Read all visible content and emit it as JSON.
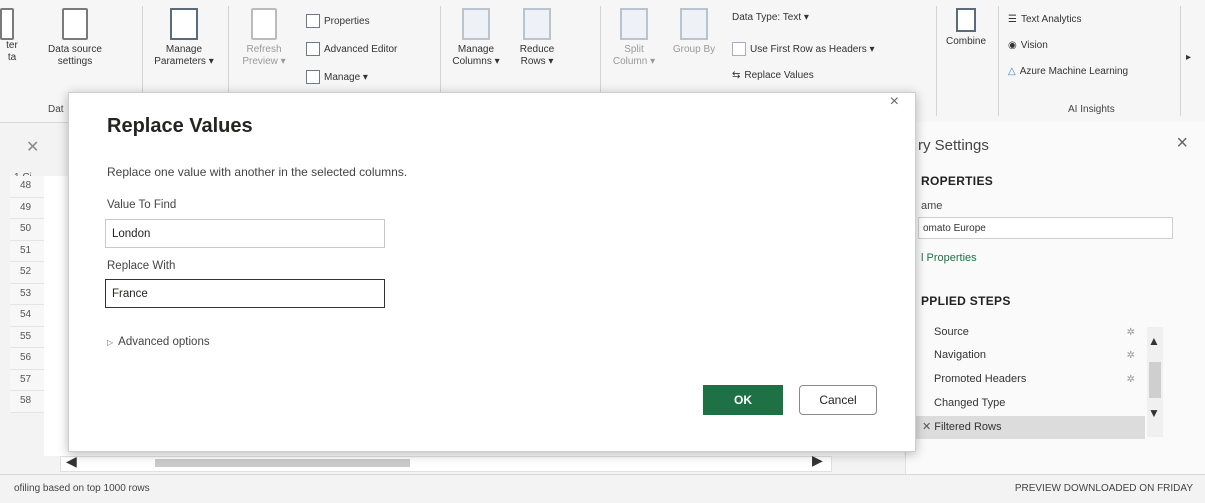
{
  "ribbon": {
    "left_cut_label_1": "ter",
    "left_cut_label_2": "ta",
    "data_source_settings": "Data source settings",
    "manage_parameters": "Manage Parameters ▾",
    "refresh_preview": "Refresh Preview ▾",
    "properties": "Properties",
    "advanced_editor": "Advanced Editor",
    "manage": "Manage ▾",
    "manage_columns": "Manage Columns ▾",
    "reduce_rows": "Reduce Rows ▾",
    "split_column": "Split Column ▾",
    "group_by": "Group By",
    "data_type": "Data Type: Text ▾",
    "use_first_row": "Use First Row as Headers ▾",
    "replace_values": "Replace Values",
    "combine": "Combine",
    "text_analytics": "Text Analytics",
    "vision": "Vision",
    "azure_ml": "Azure Machine Learning",
    "ai_insights": "AI Insights",
    "data_group_cut": "Dat"
  },
  "dialog": {
    "title": "Replace Values",
    "description": "Replace one value with another in the selected columns.",
    "value_to_find_label": "Value To Find",
    "value_to_find": "London",
    "replace_with_label": "Replace With",
    "replace_with": "France",
    "advanced_options": "Advanced options",
    "ok": "OK",
    "cancel": "Cancel",
    "close_glyph": "×"
  },
  "grid": {
    "column_header": "1 Ci",
    "row_numbers": [
      "48",
      "49",
      "50",
      "51",
      "52",
      "53",
      "54",
      "55",
      "56",
      "57",
      "58"
    ]
  },
  "query_settings": {
    "title": "ry Settings",
    "properties_head": "ROPERTIES",
    "name_label": "ame",
    "name_value": "omato Europe",
    "all_properties": "l Properties",
    "applied_steps_head": "PPLIED STEPS",
    "steps": [
      {
        "label": "Source",
        "gear": true
      },
      {
        "label": "Navigation",
        "gear": true
      },
      {
        "label": "Promoted Headers",
        "gear": true
      },
      {
        "label": "Changed Type",
        "gear": false
      },
      {
        "label": "Filtered Rows",
        "gear": false,
        "selected": true
      }
    ]
  },
  "status": {
    "left": "ofiling based on top 1000 rows",
    "right": "PREVIEW DOWNLOADED ON FRIDAY"
  },
  "colors": {
    "accent_green": "#1e7145",
    "ok_button": "#1e7145"
  }
}
